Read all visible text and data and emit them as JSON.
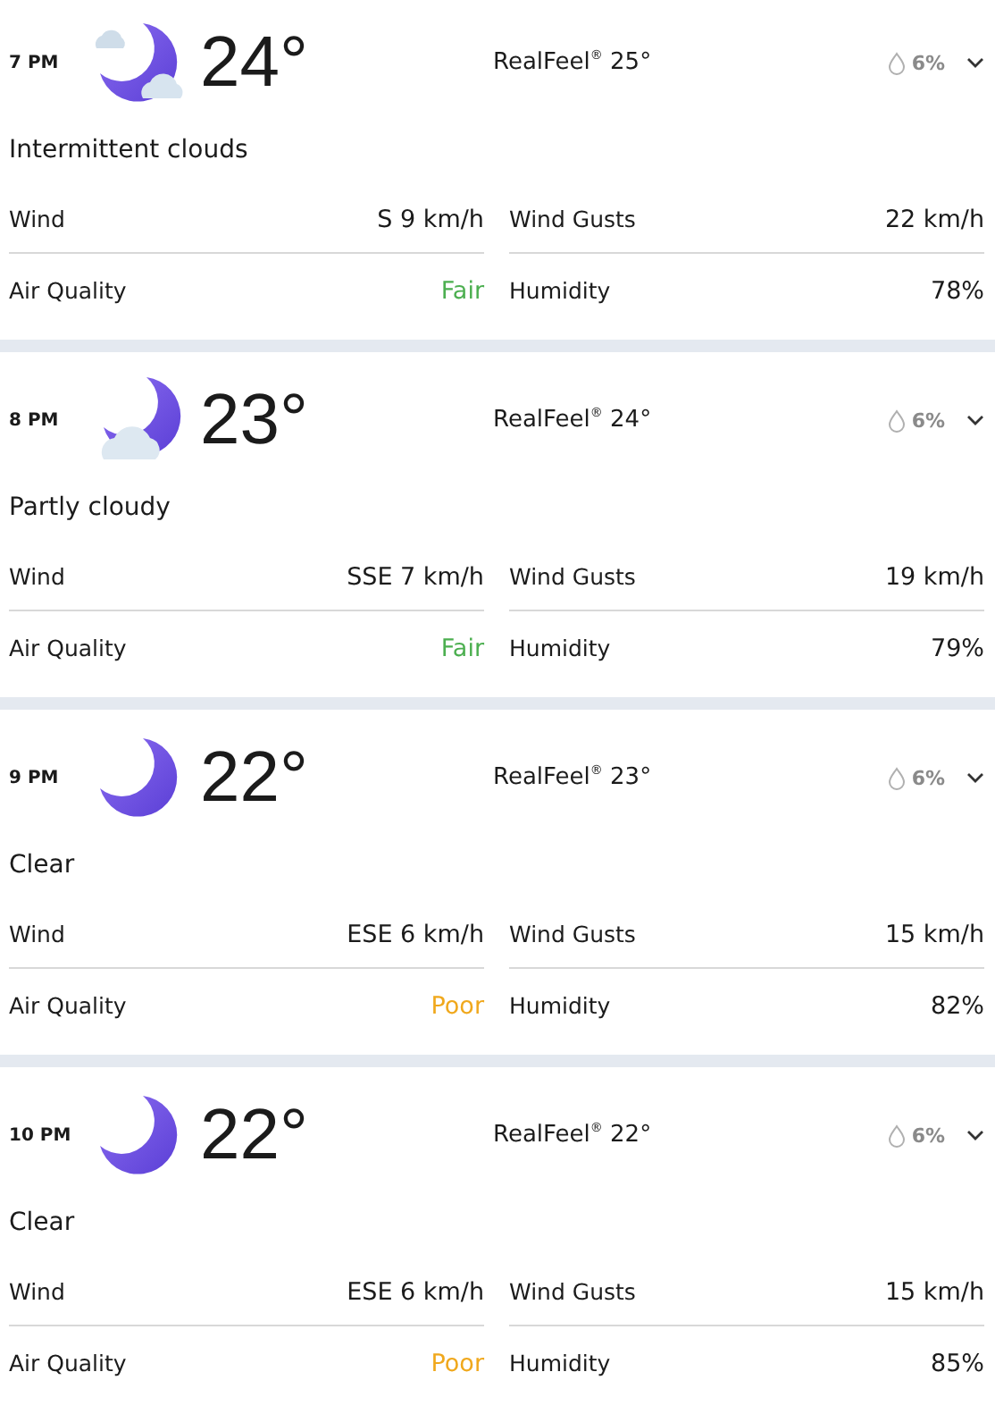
{
  "hours": [
    {
      "time": "7 PM",
      "kind": "moon-clouds",
      "temp": "24°",
      "realfeel": "RealFeel$^{®}$ 25°",
      "precip": "6%",
      "condition": "Intermittent clouds",
      "left": [
        {
          "label": "Wind",
          "value": "S 9 km/h"
        },
        {
          "label": "Air Quality",
          "value": "Fair",
          "color": "#4caf50"
        }
      ],
      "right": [
        {
          "label": "Wind Gusts",
          "value": "22 km/h"
        },
        {
          "label": "Humidity",
          "value": "78%"
        }
      ]
    },
    {
      "time": "8 PM",
      "kind": "moon-cloud",
      "temp": "23°",
      "realfeel": "RealFeel$^{®}$ 24°",
      "precip": "6%",
      "condition": "Partly cloudy",
      "left": [
        {
          "label": "Wind",
          "value": "SSE 7 km/h"
        },
        {
          "label": "Air Quality",
          "value": "Fair",
          "color": "#4caf50"
        }
      ],
      "right": [
        {
          "label": "Wind Gusts",
          "value": "19 km/h"
        },
        {
          "label": "Humidity",
          "value": "79%"
        }
      ]
    },
    {
      "time": "9 PM",
      "kind": "moon",
      "temp": "22°",
      "realfeel": "RealFeel$^{®}$ 23°",
      "precip": "6%",
      "condition": "Clear",
      "left": [
        {
          "label": "Wind",
          "value": "ESE 6 km/h"
        },
        {
          "label": "Air Quality",
          "value": "Poor",
          "color": "#f0a81c"
        }
      ],
      "right": [
        {
          "label": "Wind Gusts",
          "value": "15 km/h"
        },
        {
          "label": "Humidity",
          "value": "82%"
        }
      ]
    },
    {
      "time": "10 PM",
      "kind": "moon",
      "temp": "22°",
      "realfeel": "RealFeel$^{®}$ 22°",
      "precip": "6%",
      "condition": "Clear",
      "left": [
        {
          "label": "Wind",
          "value": "ESE 6 km/h"
        },
        {
          "label": "Air Quality",
          "value": "Poor",
          "color": "#f0a81c"
        }
      ],
      "right": [
        {
          "label": "Wind Gusts",
          "value": "15 km/h"
        },
        {
          "label": "Humidity",
          "value": "85%"
        }
      ]
    }
  ]
}
